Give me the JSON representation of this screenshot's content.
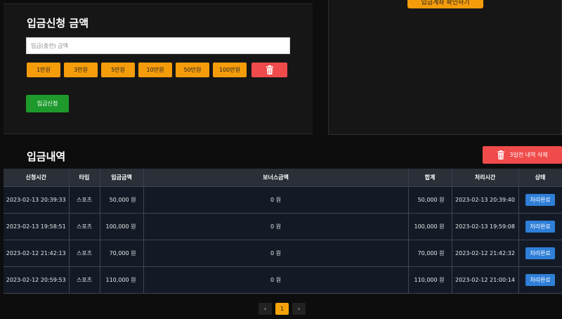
{
  "right_panel": {
    "button_label": "입금계좌 확인하기"
  },
  "deposit": {
    "title": "입금신청 금액",
    "input_placeholder": "입금(충전) 금액",
    "amounts": [
      "1만원",
      "3만원",
      "5만원",
      "10만원",
      "50만원",
      "100만원"
    ],
    "submit_label": "입금신청"
  },
  "history": {
    "title": "입금내역",
    "delete_old_label": "3일전 내역 삭제",
    "columns": [
      "신청시간",
      "타입",
      "입금금액",
      "보너스금액",
      "합계",
      "처리시간",
      "상태"
    ],
    "rows": [
      [
        "2023-02-13 20:39:33",
        "스포츠",
        "50,000 원",
        "0 원",
        "50,000 원",
        "2023-02-13 20:39:40",
        "처리완료"
      ],
      [
        "2023-02-13 19:58:51",
        "스포츠",
        "100,000 원",
        "0 원",
        "100,000 원",
        "2023-02-13 19:59:08",
        "처리완료"
      ],
      [
        "2023-02-12 21:42:13",
        "스포츠",
        "70,000 원",
        "0 원",
        "70,000 원",
        "2023-02-12 21:42:32",
        "처리완료"
      ],
      [
        "2023-02-12 20:59:53",
        "스포츠",
        "110,000 원",
        "0 원",
        "110,000 원",
        "2023-02-12 21:00:14",
        "처리완료"
      ]
    ]
  },
  "pagination": {
    "prev": "‹",
    "current": "1",
    "next": "›"
  },
  "colors": {
    "orange": "#f59c0b",
    "red": "#f04b4b",
    "green": "#1e9a2c",
    "blue": "#2f7fd8"
  }
}
